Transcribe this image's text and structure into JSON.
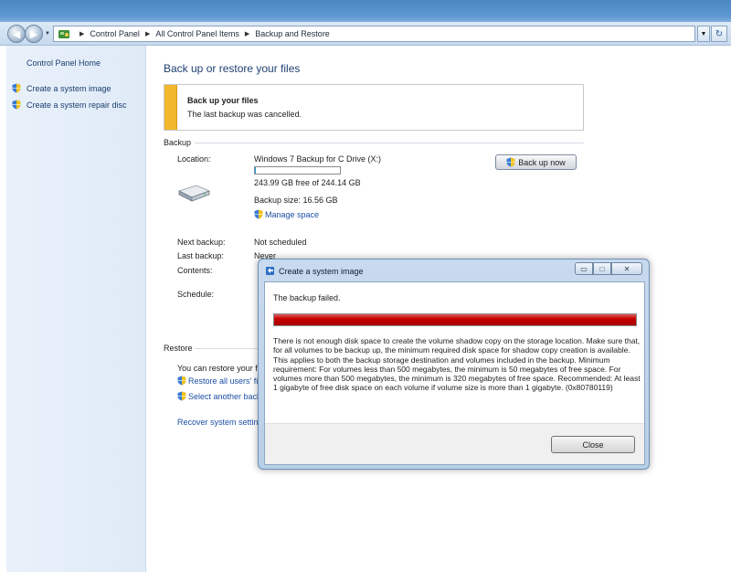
{
  "window": {
    "breadcrumb": [
      "Control Panel",
      "All Control Panel Items",
      "Backup and Restore"
    ],
    "nav_back_icon": "back-arrow-icon",
    "nav_forward_icon": "forward-arrow-icon",
    "refresh_icon": "refresh-icon"
  },
  "sidebar": {
    "home": "Control Panel Home",
    "links": [
      "Create a system image",
      "Create a system repair disc"
    ]
  },
  "main": {
    "title": "Back up or restore your files",
    "notice": {
      "title": "Back up your files",
      "text": "The last backup was cancelled.",
      "accent_color": "#f2b72a"
    },
    "backup": {
      "section_label": "Backup",
      "location_label": "Location:",
      "location_value": "Windows 7 Backup for C Drive (X:)",
      "free_space": "243.99 GB free of 244.14 GB",
      "used_fraction": 0.0006,
      "backup_size": "Backup size: 16.56 GB",
      "manage_space": "Manage space",
      "backup_now": "Back up now",
      "next_label": "Next backup:",
      "next_value": "Not scheduled",
      "last_label": "Last backup:",
      "last_value": "Never",
      "contents_label": "Contents:",
      "schedule_label": "Schedule:"
    },
    "restore": {
      "section_label": "Restore",
      "text": "You can restore your f",
      "links": [
        "Restore all users' fil",
        "Select another back"
      ],
      "recover_link": "Recover system settin"
    }
  },
  "dialog": {
    "title": "Create a system image",
    "message": "The backup failed.",
    "progress_fraction": 1.0,
    "progress_color": "#c80000",
    "error_text": "There is not enough disk space to create the volume shadow copy on the storage location. Make sure that, for all volumes to be backup up, the minimum required disk space for shadow copy creation is available. This applies to both the backup storage destination and volumes included in the backup. Minimum requirement: For volumes less than 500 megabytes, the minimum is 50 megabytes of free space. For volumes more than 500 megabytes, the minimum is 320 megabytes of free space.  Recommended: At least 1 gigabyte of free disk space on each volume if volume size is more than 1 gigabyte. (0x80780119)",
    "close_button": "Close"
  }
}
